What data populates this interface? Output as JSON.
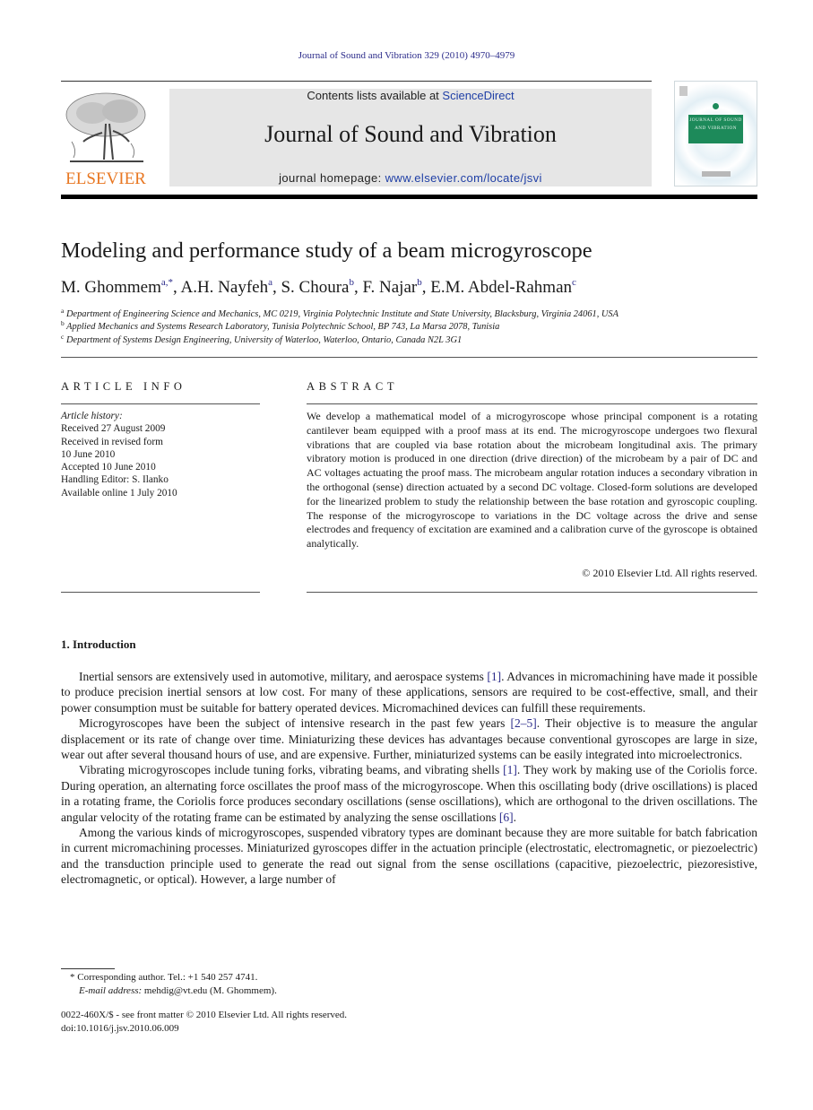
{
  "header": {
    "citation": "Journal of Sound and Vibration 329 (2010) 4970–4979",
    "publisher_logo_text": "ELSEVIER",
    "contents_prefix": "Contents lists available at ",
    "contents_link": "ScienceDirect",
    "journal_title": "Journal of Sound and Vibration",
    "homepage_prefix": "journal homepage: ",
    "homepage_link": "www.elsevier.com/locate/jsvi",
    "cover_text": "JOURNAL OF SOUND AND VIBRATION"
  },
  "article": {
    "title": "Modeling and performance study of a beam microgyroscope",
    "authors": [
      {
        "name": "M. Ghommem",
        "sup": "a,*",
        "sep": ", "
      },
      {
        "name": "A.H. Nayfeh",
        "sup": "a",
        "sep": ", "
      },
      {
        "name": "S. Choura",
        "sup": "b",
        "sep": ", "
      },
      {
        "name": "F. Najar",
        "sup": "b",
        "sep": ", "
      },
      {
        "name": "E.M. Abdel-Rahman",
        "sup": "c",
        "sep": ""
      }
    ],
    "affiliations": [
      {
        "key": "a",
        "text": "Department of Engineering Science and Mechanics, MC 0219, Virginia Polytechnic Institute and State University, Blacksburg, Virginia 24061, USA"
      },
      {
        "key": "b",
        "text": "Applied Mechanics and Systems Research Laboratory, Tunisia Polytechnic School, BP 743, La Marsa 2078, Tunisia"
      },
      {
        "key": "c",
        "text": "Department of Systems Design Engineering, University of Waterloo, Waterloo, Ontario, Canada N2L 3G1"
      }
    ]
  },
  "article_info": {
    "heading": "ARTICLE INFO",
    "history_label": "Article history:",
    "history": [
      "Received 27 August 2009",
      "Received in revised form",
      "10 June 2010",
      "Accepted 10 June 2010",
      "Handling Editor: S. Ilanko",
      "Available online 1 July 2010"
    ]
  },
  "abstract": {
    "heading": "ABSTRACT",
    "text": "We develop a mathematical model of a microgyroscope whose principal component is a rotating cantilever beam equipped with a proof mass at its end. The microgyroscope undergoes two flexural vibrations that are coupled via base rotation about the microbeam longitudinal axis. The primary vibratory motion is produced in one direction (drive direction) of the microbeam by a pair of DC and AC voltages actuating the proof mass. The microbeam angular rotation induces a secondary vibration in the orthogonal (sense) direction actuated by a second DC voltage. Closed-form solutions are developed for the linearized problem to study the relationship between the base rotation and gyroscopic coupling. The response of the microgyroscope to variations in the DC voltage across the drive and sense electrodes and frequency of excitation are examined and a calibration curve of the gyroscope is obtained analytically.",
    "copyright": "© 2010 Elsevier Ltd. All rights reserved."
  },
  "introduction": {
    "heading": "1.  Introduction",
    "paragraphs": [
      {
        "pre": "Inertial sensors are extensively used in automotive, military, and aerospace systems ",
        "ref": "[1]",
        "post": ". Advances in micromachining have made it possible to produce precision inertial sensors at low cost. For many of these applications, sensors are required to be cost-effective, small, and their power consumption must be suitable for battery operated devices. Micromachined devices can fulfill these requirements."
      },
      {
        "pre": "Microgyroscopes have been the subject of intensive research in the past few years ",
        "ref": "[2–5]",
        "post": ". Their objective is to measure the angular displacement or its rate of change over time. Miniaturizing these devices has advantages because conventional gyroscopes are large in size, wear out after several thousand hours of use, and are expensive. Further, miniaturized systems can be easily integrated into microelectronics."
      },
      {
        "pre": "Vibrating microgyroscopes include tuning forks, vibrating beams, and vibrating shells ",
        "ref": "[1]",
        "post": ". They work by making use of the Coriolis force. During operation, an alternating force oscillates the proof mass of the microgyroscope. When this oscillating body (drive oscillations) is placed in a rotating frame, the Coriolis force produces secondary oscillations (sense oscillations), which are orthogonal to the driven oscillations. The angular velocity of the rotating frame can be estimated by analyzing the sense oscillations "
      },
      {
        "pre": "Among the various kinds of microgyroscopes, suspended vibratory types are dominant because they are more suitable for batch fabrication in current micromachining processes. Miniaturized gyroscopes differ in the actuation principle (electrostatic, electromagnetic, or piezoelectric) and the transduction principle used to generate the read out signal from the sense oscillations (capacitive, piezoelectric, piezoresistive, electromagnetic, or optical). However, a large number of",
        "ref": "",
        "post": ""
      }
    ],
    "para3_ref2": "[6]",
    "para3_end": "."
  },
  "footnotes": {
    "corresponding": "* Corresponding author. Tel.: +1 540 257 4741.",
    "email_label": "E-mail address:",
    "email_value": " mehdig@vt.edu (M. Ghommem).",
    "issn_line": "0022-460X/$ - see front matter © 2010 Elsevier Ltd. All rights reserved.",
    "doi": "doi:10.1016/j.jsv.2010.06.009"
  },
  "colors": {
    "link": "#1f3fa6",
    "ref": "#2b2b8a",
    "elsevier_orange": "#e87722",
    "cover_green": "#1d8a5a"
  }
}
